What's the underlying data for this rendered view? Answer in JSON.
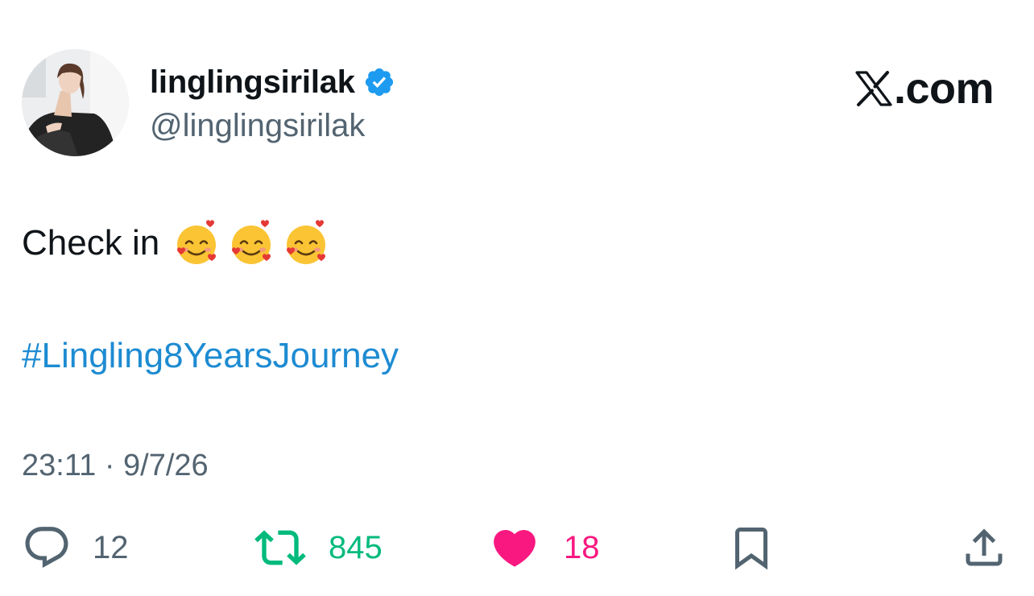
{
  "colors": {
    "text_primary": "#0f1419",
    "text_secondary": "#536471",
    "link": "#1d8bd2",
    "verified": "#1d9bf0",
    "retweet_active": "#00ba7c",
    "like_active": "#f91880"
  },
  "author": {
    "display_name": "linglingsirilak",
    "handle": "@linglingsirilak",
    "verified_icon": "verified-badge-icon"
  },
  "brand": {
    "text": ".com",
    "icon": "x-logo-icon"
  },
  "tweet": {
    "text": "Check in",
    "emojis": [
      "smiling-face-with-hearts",
      "smiling-face-with-hearts",
      "smiling-face-with-hearts"
    ],
    "hashtag": "#Lingling8YearsJourney",
    "timestamp": "23:11 · 9/7/26"
  },
  "actions": {
    "reply": {
      "icon": "reply-bubble-icon",
      "count": "12"
    },
    "retweet": {
      "icon": "retweet-icon",
      "count": "845"
    },
    "like": {
      "icon": "heart-icon",
      "count": "18"
    },
    "bookmark": {
      "icon": "bookmark-icon"
    },
    "share": {
      "icon": "share-icon"
    }
  }
}
